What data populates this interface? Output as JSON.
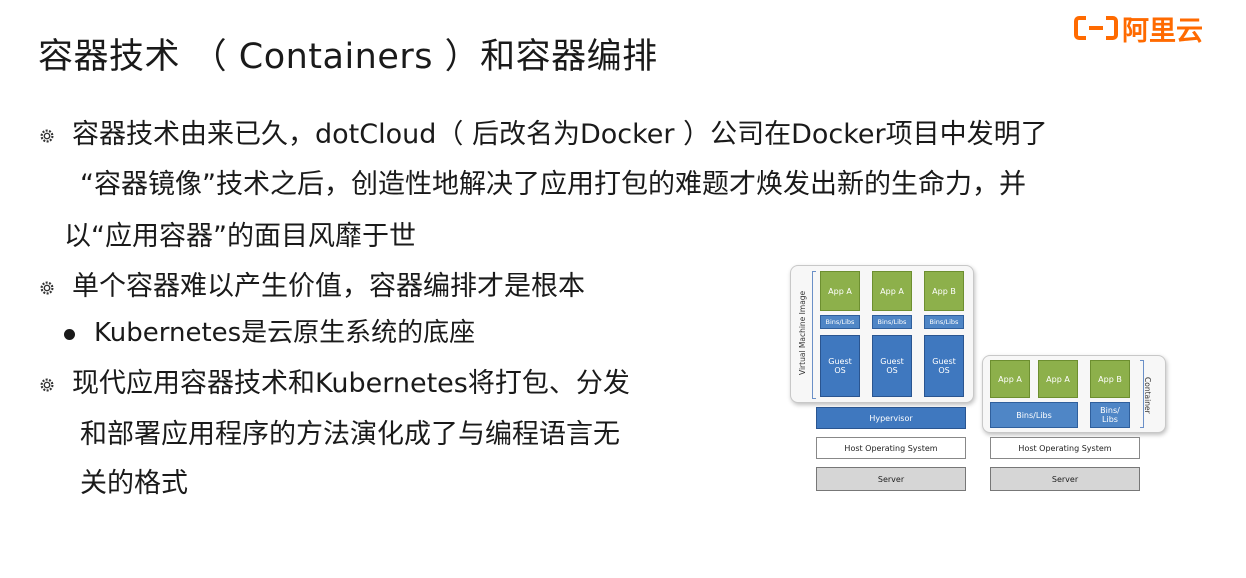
{
  "slide": {
    "title": "容器技术 （ Containers ）和容器编排",
    "logo_text": "阿里云",
    "accent_color": "#ff6a00"
  },
  "bullets": [
    {
      "icon": "gear-bullet-icon",
      "lines": [
        "容器技术由来已久，dotCloud（ 后改名为Docker ）公司在Docker项目中发明了",
        "“容器镜像”技术之后，创造性地解决了应用打包的难题才焕发出新的生命力，并",
        "以“应用容器”的面目风靡于世"
      ]
    },
    {
      "icon": "gear-bullet-icon",
      "lines": [
        "单个容器难以产生价值，容器编排才是根本"
      ]
    },
    {
      "icon": "dot-bullet-icon",
      "lines": [
        "Kubernetes是云原生系统的底座"
      ]
    },
    {
      "icon": "gear-bullet-icon",
      "lines": [
        "现代应用容器技术和Kubernetes将打包、分发",
        "和部署应用程序的方法演化成了与编程语言无",
        "关的格式"
      ]
    }
  ],
  "diagram": {
    "vm": {
      "side_label": "Virtual Machine Image",
      "apps": [
        "App A",
        "App A",
        "App B"
      ],
      "bins": [
        "Bins/Libs",
        "Bins/Libs",
        "Bins/Libs"
      ],
      "guest": [
        "Guest\nOS",
        "Guest\nOS",
        "Guest\nOS"
      ],
      "hypervisor": "Hypervisor",
      "host_os": "Host Operating System",
      "server": "Server"
    },
    "container": {
      "side_label": "Container",
      "apps": [
        "App A",
        "App A",
        "App B"
      ],
      "bins_shared": "Bins/Libs",
      "bins_b": "Bins/\nLibs",
      "host_os": "Host Operating System",
      "server": "Server"
    },
    "colors": {
      "app": "#8db04b",
      "bins": "#4f86c6",
      "guest": "#3f78bf",
      "server": "#d6d6d6"
    }
  }
}
